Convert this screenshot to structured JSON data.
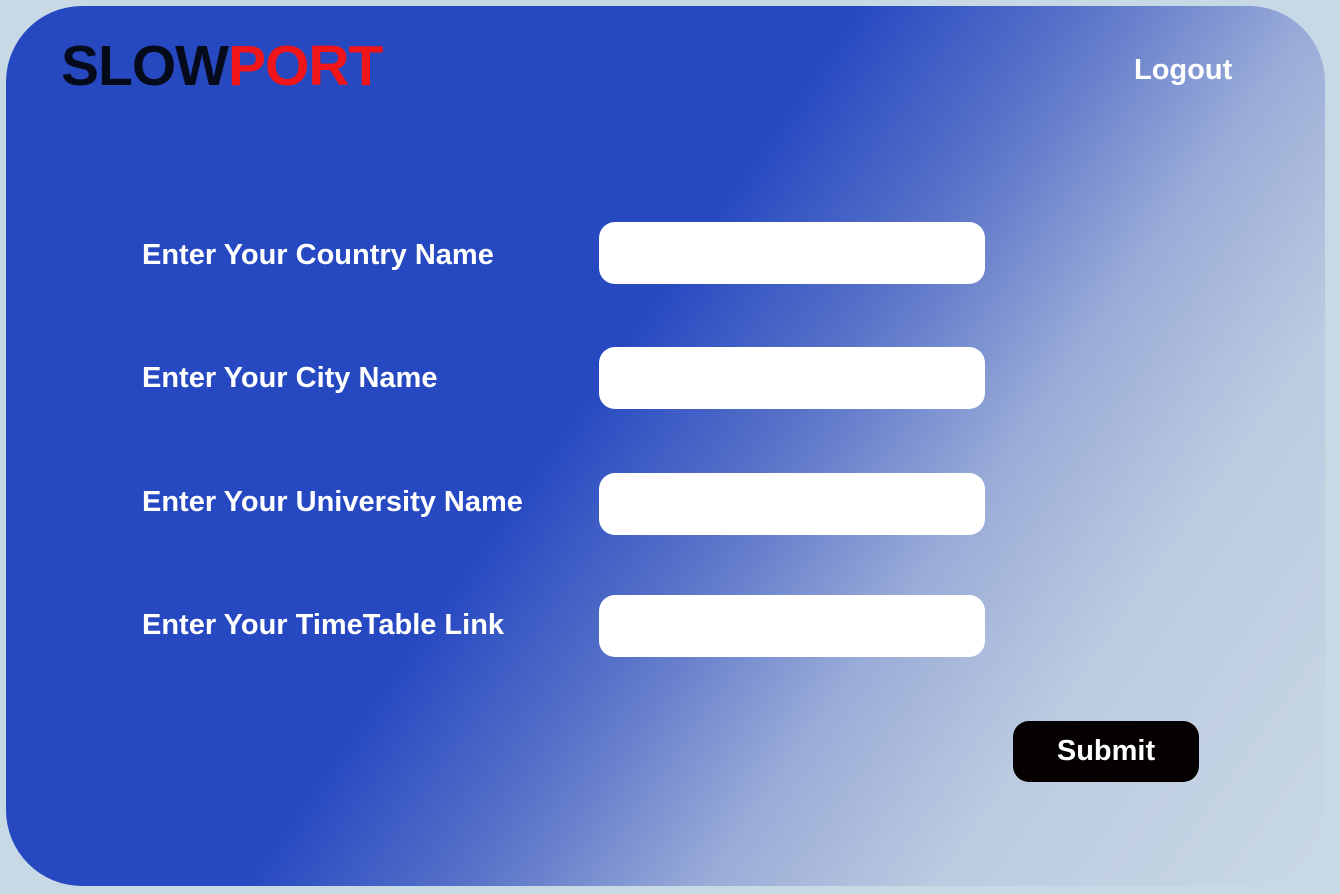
{
  "header": {
    "logo_part1": "SLOW",
    "logo_part2": "PORT",
    "logout_label": "Logout"
  },
  "form": {
    "fields": [
      {
        "label": "Enter Your Country Name",
        "value": "",
        "placeholder": ""
      },
      {
        "label": "Enter Your City Name",
        "value": "",
        "placeholder": ""
      },
      {
        "label": "Enter Your University Name",
        "value": "",
        "placeholder": ""
      },
      {
        "label": "Enter Your TimeTable Link",
        "value": "",
        "placeholder": ""
      }
    ],
    "submit_label": "Submit"
  },
  "colors": {
    "page_background": "#c8d9e6",
    "card_primary": "#2649c1",
    "logo_dark": "#060b1c",
    "logo_accent": "#ef1518",
    "button": "#050102",
    "text_light": "#ffffff"
  }
}
